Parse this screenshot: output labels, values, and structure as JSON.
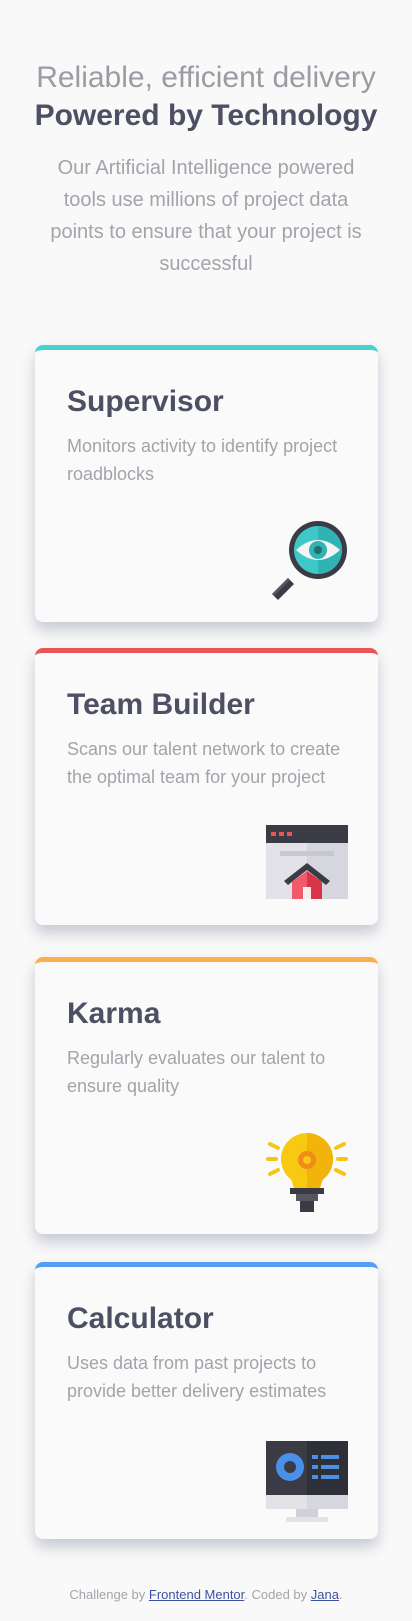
{
  "header": {
    "line1": "Reliable, efficient delivery",
    "line2": "Powered by Technology",
    "intro": "Our Artificial Intelligence powered tools use millions of project data points to ensure that your project is successful"
  },
  "cards": [
    {
      "title": "Supervisor",
      "desc": "Monitors activity to identify project roadblocks",
      "accent": "#44d3d2",
      "icon": "magnifier-eye-icon"
    },
    {
      "title": "Team Builder",
      "desc": "Scans our talent network to create the optimal team for your project",
      "accent": "#ea5454",
      "icon": "browser-house-icon"
    },
    {
      "title": "Karma",
      "desc": "Regularly evaluates our talent to ensure quality",
      "accent": "#fcaf4a",
      "icon": "lightbulb-icon"
    },
    {
      "title": "Calculator",
      "desc": "Uses data from past projects to provide better delivery estimates",
      "accent": "#549ef2",
      "icon": "monitor-icon"
    }
  ],
  "footer": {
    "prefix": "Challenge by ",
    "link1": "Frontend Mentor",
    "middle": ". Coded by ",
    "link2": "Jana",
    "suffix": "."
  }
}
